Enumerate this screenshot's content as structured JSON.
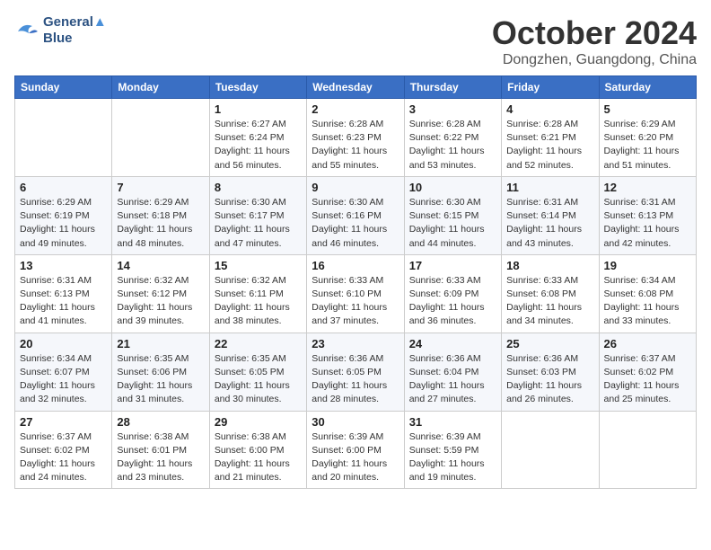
{
  "header": {
    "logo_line1": "General",
    "logo_line2": "Blue",
    "month_title": "October 2024",
    "location": "Dongzhen, Guangdong, China"
  },
  "weekdays": [
    "Sunday",
    "Monday",
    "Tuesday",
    "Wednesday",
    "Thursday",
    "Friday",
    "Saturday"
  ],
  "weeks": [
    [
      {
        "day": "",
        "info": ""
      },
      {
        "day": "",
        "info": ""
      },
      {
        "day": "1",
        "info": "Sunrise: 6:27 AM\nSunset: 6:24 PM\nDaylight: 11 hours and 56 minutes."
      },
      {
        "day": "2",
        "info": "Sunrise: 6:28 AM\nSunset: 6:23 PM\nDaylight: 11 hours and 55 minutes."
      },
      {
        "day": "3",
        "info": "Sunrise: 6:28 AM\nSunset: 6:22 PM\nDaylight: 11 hours and 53 minutes."
      },
      {
        "day": "4",
        "info": "Sunrise: 6:28 AM\nSunset: 6:21 PM\nDaylight: 11 hours and 52 minutes."
      },
      {
        "day": "5",
        "info": "Sunrise: 6:29 AM\nSunset: 6:20 PM\nDaylight: 11 hours and 51 minutes."
      }
    ],
    [
      {
        "day": "6",
        "info": "Sunrise: 6:29 AM\nSunset: 6:19 PM\nDaylight: 11 hours and 49 minutes."
      },
      {
        "day": "7",
        "info": "Sunrise: 6:29 AM\nSunset: 6:18 PM\nDaylight: 11 hours and 48 minutes."
      },
      {
        "day": "8",
        "info": "Sunrise: 6:30 AM\nSunset: 6:17 PM\nDaylight: 11 hours and 47 minutes."
      },
      {
        "day": "9",
        "info": "Sunrise: 6:30 AM\nSunset: 6:16 PM\nDaylight: 11 hours and 46 minutes."
      },
      {
        "day": "10",
        "info": "Sunrise: 6:30 AM\nSunset: 6:15 PM\nDaylight: 11 hours and 44 minutes."
      },
      {
        "day": "11",
        "info": "Sunrise: 6:31 AM\nSunset: 6:14 PM\nDaylight: 11 hours and 43 minutes."
      },
      {
        "day": "12",
        "info": "Sunrise: 6:31 AM\nSunset: 6:13 PM\nDaylight: 11 hours and 42 minutes."
      }
    ],
    [
      {
        "day": "13",
        "info": "Sunrise: 6:31 AM\nSunset: 6:13 PM\nDaylight: 11 hours and 41 minutes."
      },
      {
        "day": "14",
        "info": "Sunrise: 6:32 AM\nSunset: 6:12 PM\nDaylight: 11 hours and 39 minutes."
      },
      {
        "day": "15",
        "info": "Sunrise: 6:32 AM\nSunset: 6:11 PM\nDaylight: 11 hours and 38 minutes."
      },
      {
        "day": "16",
        "info": "Sunrise: 6:33 AM\nSunset: 6:10 PM\nDaylight: 11 hours and 37 minutes."
      },
      {
        "day": "17",
        "info": "Sunrise: 6:33 AM\nSunset: 6:09 PM\nDaylight: 11 hours and 36 minutes."
      },
      {
        "day": "18",
        "info": "Sunrise: 6:33 AM\nSunset: 6:08 PM\nDaylight: 11 hours and 34 minutes."
      },
      {
        "day": "19",
        "info": "Sunrise: 6:34 AM\nSunset: 6:08 PM\nDaylight: 11 hours and 33 minutes."
      }
    ],
    [
      {
        "day": "20",
        "info": "Sunrise: 6:34 AM\nSunset: 6:07 PM\nDaylight: 11 hours and 32 minutes."
      },
      {
        "day": "21",
        "info": "Sunrise: 6:35 AM\nSunset: 6:06 PM\nDaylight: 11 hours and 31 minutes."
      },
      {
        "day": "22",
        "info": "Sunrise: 6:35 AM\nSunset: 6:05 PM\nDaylight: 11 hours and 30 minutes."
      },
      {
        "day": "23",
        "info": "Sunrise: 6:36 AM\nSunset: 6:05 PM\nDaylight: 11 hours and 28 minutes."
      },
      {
        "day": "24",
        "info": "Sunrise: 6:36 AM\nSunset: 6:04 PM\nDaylight: 11 hours and 27 minutes."
      },
      {
        "day": "25",
        "info": "Sunrise: 6:36 AM\nSunset: 6:03 PM\nDaylight: 11 hours and 26 minutes."
      },
      {
        "day": "26",
        "info": "Sunrise: 6:37 AM\nSunset: 6:02 PM\nDaylight: 11 hours and 25 minutes."
      }
    ],
    [
      {
        "day": "27",
        "info": "Sunrise: 6:37 AM\nSunset: 6:02 PM\nDaylight: 11 hours and 24 minutes."
      },
      {
        "day": "28",
        "info": "Sunrise: 6:38 AM\nSunset: 6:01 PM\nDaylight: 11 hours and 23 minutes."
      },
      {
        "day": "29",
        "info": "Sunrise: 6:38 AM\nSunset: 6:00 PM\nDaylight: 11 hours and 21 minutes."
      },
      {
        "day": "30",
        "info": "Sunrise: 6:39 AM\nSunset: 6:00 PM\nDaylight: 11 hours and 20 minutes."
      },
      {
        "day": "31",
        "info": "Sunrise: 6:39 AM\nSunset: 5:59 PM\nDaylight: 11 hours and 19 minutes."
      },
      {
        "day": "",
        "info": ""
      },
      {
        "day": "",
        "info": ""
      }
    ]
  ]
}
